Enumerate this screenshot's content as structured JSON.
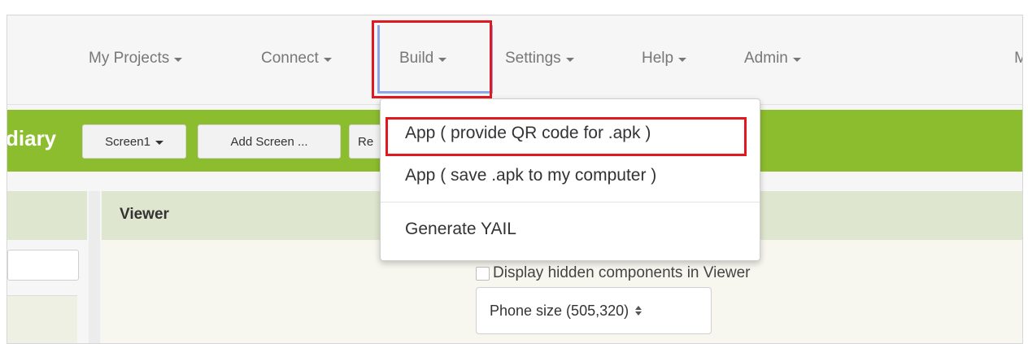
{
  "nav": {
    "my_projects": "My Projects",
    "connect": "Connect",
    "build": "Build",
    "settings": "Settings",
    "help": "Help",
    "admin": "Admin",
    "cut_right": "M"
  },
  "toolbar": {
    "project_title": "diary",
    "screen_select": "Screen1",
    "add_screen": "Add Screen ...",
    "remove_screen_partial": "Re"
  },
  "build_menu": {
    "items": [
      {
        "label": "App ( provide QR code for .apk )"
      },
      {
        "label": "App ( save .apk to my computer )"
      },
      {
        "label": "Generate YAIL"
      }
    ]
  },
  "viewer": {
    "title": "Viewer",
    "hidden_components_label": "Display hidden components in Viewer",
    "phone_size": "Phone size (505,320)"
  },
  "colors": {
    "toolbar_green": "#8cbd2e",
    "highlight_red": "#e0181f",
    "focus_blue": "#8fa6e6"
  }
}
